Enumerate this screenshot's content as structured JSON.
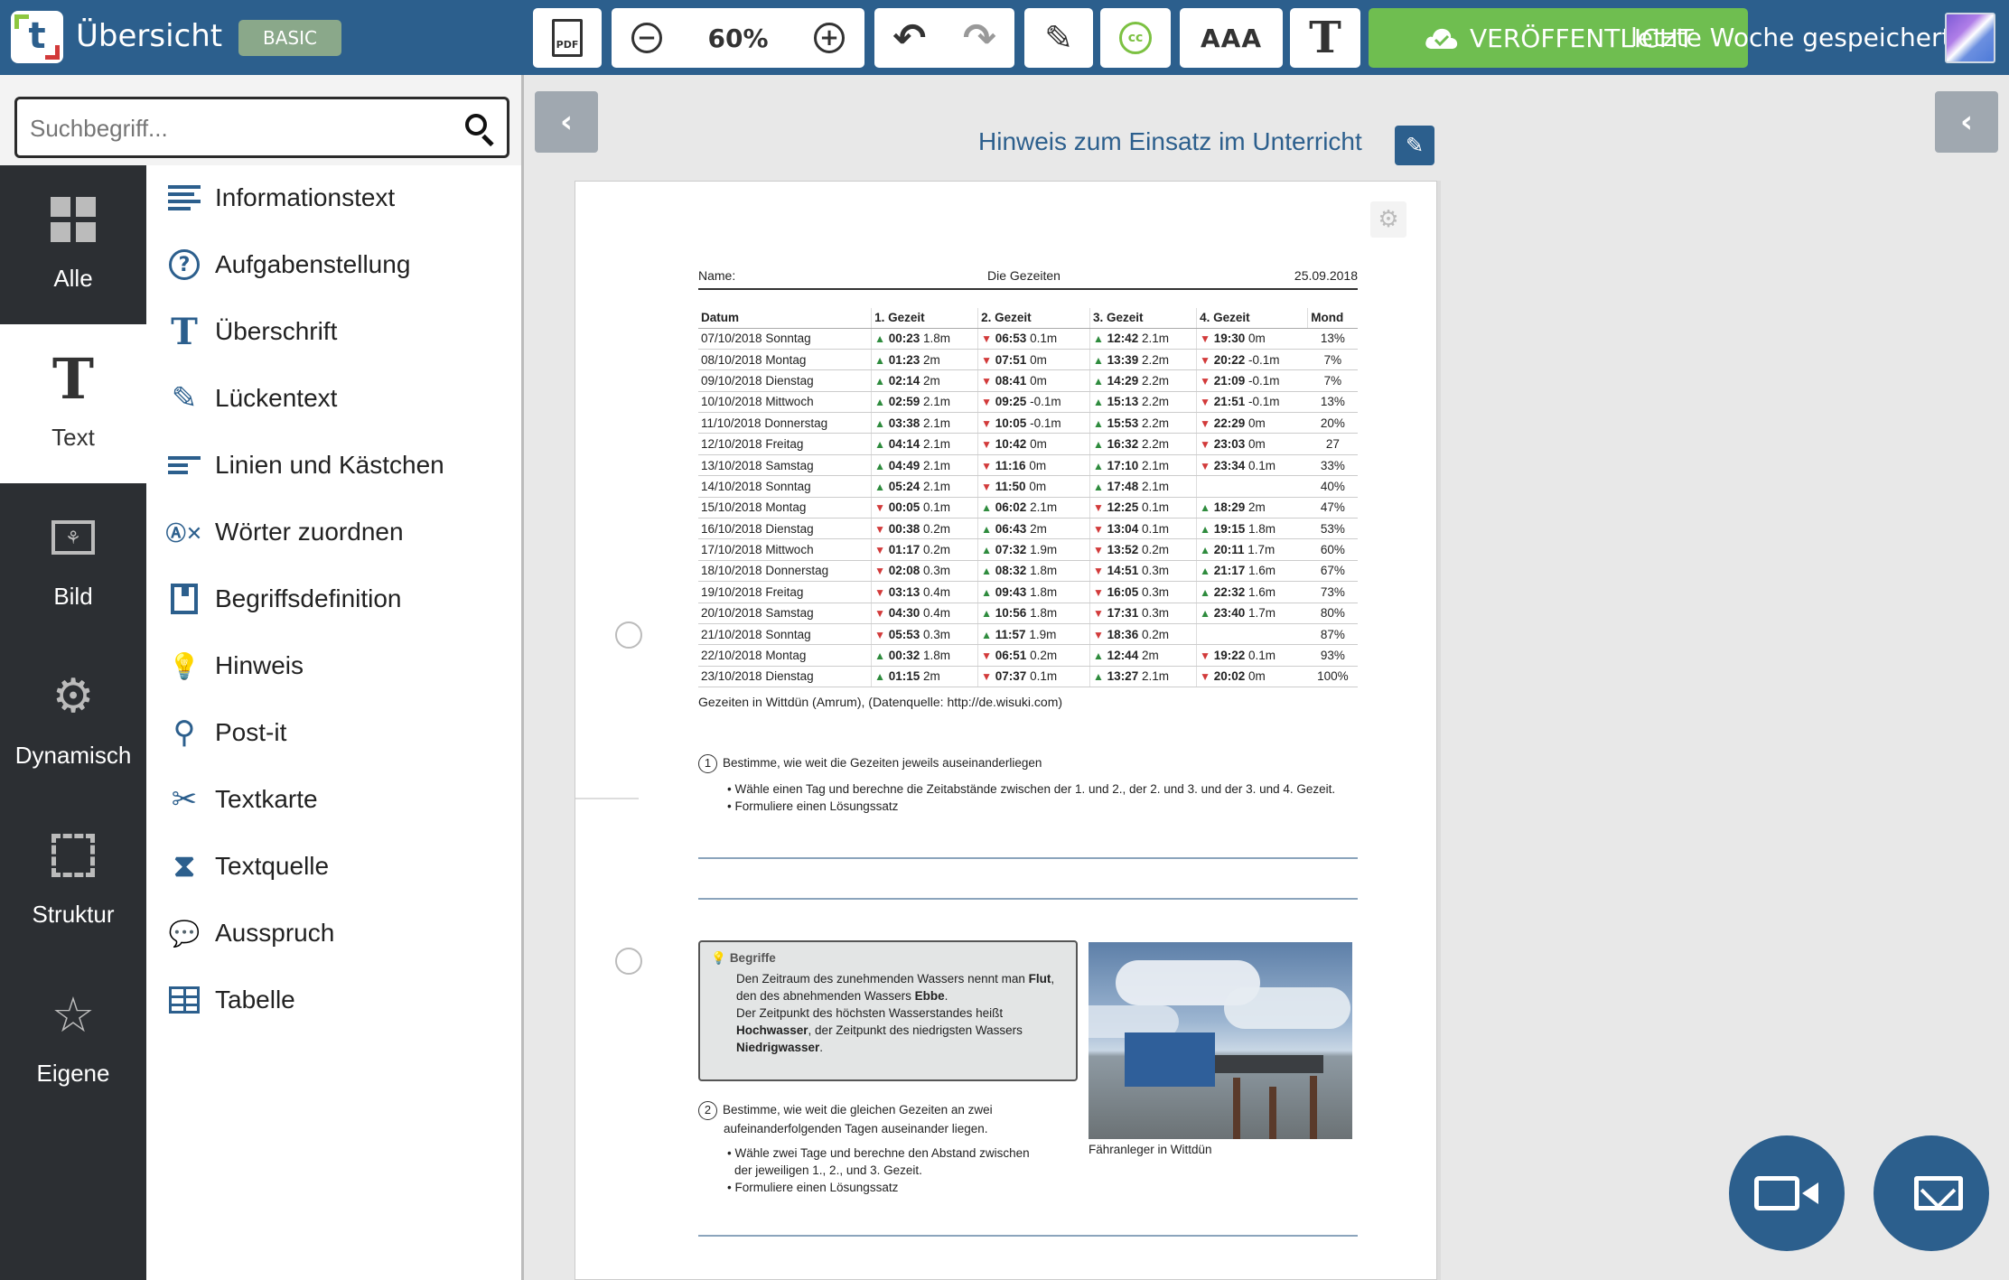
{
  "header": {
    "logo_letter": "t",
    "title": "Übersicht",
    "plan_badge": "BASIC",
    "pdf_label": "PDF",
    "zoom_out": "−",
    "zoom_level": "60%",
    "zoom_in": "+",
    "undo": "↶",
    "redo": "↷",
    "edit_glyph": "✎",
    "cc_label": "cc",
    "font_size_label": "AAA",
    "text_tool_label": "T",
    "publish_label": "VERÖFFENTLICHT",
    "saved_status": "letzte Woche gespeichert",
    "accent_color": "#2c5f8d",
    "publish_color": "#6fbe50"
  },
  "sidebar": {
    "search_placeholder": "Suchbegriff...",
    "categories": [
      {
        "label": "Alle",
        "icon": "grid-icon"
      },
      {
        "label": "Text",
        "icon": "text-icon"
      },
      {
        "label": "Bild",
        "icon": "image-icon"
      },
      {
        "label": "Dynamisch",
        "icon": "gears-icon"
      },
      {
        "label": "Struktur",
        "icon": "structure-icon"
      },
      {
        "label": "Eigene",
        "icon": "star-icon"
      }
    ],
    "active_category": "Text",
    "items": [
      {
        "label": "Informationstext",
        "icon": "lines-icon"
      },
      {
        "label": "Aufgabenstellung",
        "icon": "question-icon"
      },
      {
        "label": "Überschrift",
        "icon": "heading-icon"
      },
      {
        "label": "Lückentext",
        "icon": "pencil-box-icon"
      },
      {
        "label": "Linien und Kästchen",
        "icon": "lines-boxes-icon"
      },
      {
        "label": "Wörter zuordnen",
        "icon": "match-words-icon"
      },
      {
        "label": "Begriffsdefinition",
        "icon": "book-icon"
      },
      {
        "label": "Hinweis",
        "icon": "lightbulb-icon"
      },
      {
        "label": "Post-it",
        "icon": "pin-icon"
      },
      {
        "label": "Textkarte",
        "icon": "scissors-card-icon"
      },
      {
        "label": "Textquelle",
        "icon": "hourglass-icon"
      },
      {
        "label": "Ausspruch",
        "icon": "speech-bubble-icon"
      },
      {
        "label": "Tabelle",
        "icon": "table-icon"
      }
    ],
    "glyphs": {
      "heading": "T",
      "pencil": "✎",
      "match": "Ⓐ✕",
      "bulb": "💡",
      "pin": "⚲",
      "scissors": "✂",
      "hourglass": "⧗",
      "speech": "💬",
      "question": "?"
    }
  },
  "main": {
    "collapse_left": "‹",
    "collapse_right": "‹",
    "hint_link": "Hinweis zum Einsatz im Unterricht",
    "hint_edit": "✎",
    "page_gear": "⚙"
  },
  "worksheet": {
    "name_label": "Name:",
    "title": "Die Gezeiten",
    "date": "25.09.2018",
    "table_headers": [
      "Datum",
      "1. Gezeit",
      "2. Gezeit",
      "3. Gezeit",
      "4. Gezeit",
      "Mond"
    ],
    "rows": [
      {
        "date": "07/10/2018 Sonntag",
        "g": [
          [
            "up",
            "00:23",
            "1.8m"
          ],
          [
            "down",
            "06:53",
            "0.1m"
          ],
          [
            "up",
            "12:42",
            "2.1m"
          ],
          [
            "down",
            "19:30",
            "0m"
          ]
        ],
        "mond": "13%"
      },
      {
        "date": "08/10/2018 Montag",
        "g": [
          [
            "up",
            "01:23",
            "2m"
          ],
          [
            "down",
            "07:51",
            "0m"
          ],
          [
            "up",
            "13:39",
            "2.2m"
          ],
          [
            "down",
            "20:22",
            "-0.1m"
          ]
        ],
        "mond": "7%"
      },
      {
        "date": "09/10/2018 Dienstag",
        "g": [
          [
            "up",
            "02:14",
            "2m"
          ],
          [
            "down",
            "08:41",
            "0m"
          ],
          [
            "up",
            "14:29",
            "2.2m"
          ],
          [
            "down",
            "21:09",
            "-0.1m"
          ]
        ],
        "mond": "7%"
      },
      {
        "date": "10/10/2018 Mittwoch",
        "g": [
          [
            "up",
            "02:59",
            "2.1m"
          ],
          [
            "down",
            "09:25",
            "-0.1m"
          ],
          [
            "up",
            "15:13",
            "2.2m"
          ],
          [
            "down",
            "21:51",
            "-0.1m"
          ]
        ],
        "mond": "13%"
      },
      {
        "date": "11/10/2018 Donnerstag",
        "g": [
          [
            "up",
            "03:38",
            "2.1m"
          ],
          [
            "down",
            "10:05",
            "-0.1m"
          ],
          [
            "up",
            "15:53",
            "2.2m"
          ],
          [
            "down",
            "22:29",
            "0m"
          ]
        ],
        "mond": "20%"
      },
      {
        "date": "12/10/2018 Freitag",
        "g": [
          [
            "up",
            "04:14",
            "2.1m"
          ],
          [
            "down",
            "10:42",
            "0m"
          ],
          [
            "up",
            "16:32",
            "2.2m"
          ],
          [
            "down",
            "23:03",
            "0m"
          ]
        ],
        "mond": "27"
      },
      {
        "date": "13/10/2018 Samstag",
        "g": [
          [
            "up",
            "04:49",
            "2.1m"
          ],
          [
            "down",
            "11:16",
            "0m"
          ],
          [
            "up",
            "17:10",
            "2.1m"
          ],
          [
            "down",
            "23:34",
            "0.1m"
          ]
        ],
        "mond": "33%"
      },
      {
        "date": "14/10/2018 Sonntag",
        "g": [
          [
            "up",
            "05:24",
            "2.1m"
          ],
          [
            "down",
            "11:50",
            "0m"
          ],
          [
            "up",
            "17:48",
            "2.1m"
          ],
          [
            "",
            "",
            ""
          ]
        ],
        "mond": "40%"
      },
      {
        "date": "15/10/2018 Montag",
        "g": [
          [
            "down",
            "00:05",
            "0.1m"
          ],
          [
            "up",
            "06:02",
            "2.1m"
          ],
          [
            "down",
            "12:25",
            "0.1m"
          ],
          [
            "up",
            "18:29",
            "2m"
          ]
        ],
        "mond": "47%"
      },
      {
        "date": "16/10/2018 Dienstag",
        "g": [
          [
            "down",
            "00:38",
            "0.2m"
          ],
          [
            "up",
            "06:43",
            "2m"
          ],
          [
            "down",
            "13:04",
            "0.1m"
          ],
          [
            "up",
            "19:15",
            "1.8m"
          ]
        ],
        "mond": "53%"
      },
      {
        "date": "17/10/2018 Mittwoch",
        "g": [
          [
            "down",
            "01:17",
            "0.2m"
          ],
          [
            "up",
            "07:32",
            "1.9m"
          ],
          [
            "down",
            "13:52",
            "0.2m"
          ],
          [
            "up",
            "20:11",
            "1.7m"
          ]
        ],
        "mond": "60%"
      },
      {
        "date": "18/10/2018 Donnerstag",
        "g": [
          [
            "down",
            "02:08",
            "0.3m"
          ],
          [
            "up",
            "08:32",
            "1.8m"
          ],
          [
            "down",
            "14:51",
            "0.3m"
          ],
          [
            "up",
            "21:17",
            "1.6m"
          ]
        ],
        "mond": "67%"
      },
      {
        "date": "19/10/2018 Freitag",
        "g": [
          [
            "down",
            "03:13",
            "0.4m"
          ],
          [
            "up",
            "09:43",
            "1.8m"
          ],
          [
            "down",
            "16:05",
            "0.3m"
          ],
          [
            "up",
            "22:32",
            "1.6m"
          ]
        ],
        "mond": "73%"
      },
      {
        "date": "20/10/2018 Samstag",
        "g": [
          [
            "down",
            "04:30",
            "0.4m"
          ],
          [
            "up",
            "10:56",
            "1.8m"
          ],
          [
            "down",
            "17:31",
            "0.3m"
          ],
          [
            "up",
            "23:40",
            "1.7m"
          ]
        ],
        "mond": "80%"
      },
      {
        "date": "21/10/2018 Sonntag",
        "g": [
          [
            "down",
            "05:53",
            "0.3m"
          ],
          [
            "up",
            "11:57",
            "1.9m"
          ],
          [
            "down",
            "18:36",
            "0.2m"
          ],
          [
            "",
            "",
            ""
          ]
        ],
        "mond": "87%"
      },
      {
        "date": "22/10/2018 Montag",
        "g": [
          [
            "up",
            "00:32",
            "1.8m"
          ],
          [
            "down",
            "06:51",
            "0.2m"
          ],
          [
            "up",
            "12:44",
            "2m"
          ],
          [
            "down",
            "19:22",
            "0.1m"
          ]
        ],
        "mond": "93%"
      },
      {
        "date": "23/10/2018 Dienstag",
        "g": [
          [
            "up",
            "01:15",
            "2m"
          ],
          [
            "down",
            "07:37",
            "0.1m"
          ],
          [
            "up",
            "13:27",
            "2.1m"
          ],
          [
            "down",
            "20:02",
            "0m"
          ]
        ],
        "mond": "100%"
      }
    ],
    "arrows": {
      "up": "▲",
      "down": "▼"
    },
    "caption": "Gezeiten in Wittdün (Amrum), (Datenquelle: http://de.wisuki.com)",
    "task1": {
      "number": "1",
      "text": "Bestimme, wie weit die Gezeiten jeweils auseinanderliegen",
      "bullets": [
        "• Wähle einen Tag und berechne die Zeitabstände zwischen der 1. und 2., der 2. und 3. und der 3. und 4. Gezeit.",
        "• Formuliere einen Lösungssatz"
      ]
    },
    "begriffe": {
      "title": "Begriffe",
      "p1_a": "Den Zeitraum des zunehmenden Wassers nennt man ",
      "p1_b": "Flut",
      "p1_c": ", den des abnehmenden Wassers ",
      "p1_d": "Ebbe",
      "p1_e": ".",
      "p2_a": "Der Zeitpunkt des höchsten Wasserstandes heißt ",
      "p2_b": "Hochwasser",
      "p2_c": ", der Zeitpunkt des niedrigsten Wassers ",
      "p2_d": "Niedrigwasser",
      "p2_e": "."
    },
    "task2": {
      "number": "2",
      "text": "Bestimme, wie weit die gleichen Gezeiten an zwei aufeinanderfolgenden Tagen auseinander liegen.",
      "bullets": [
        "• Wähle zwei Tage und berechne den Abstand zwischen der jeweiligen 1., 2., und 3. Gezeit.",
        "• Formuliere einen Lösungssatz"
      ]
    },
    "photo_caption": "Fähranleger in Wittdün"
  }
}
